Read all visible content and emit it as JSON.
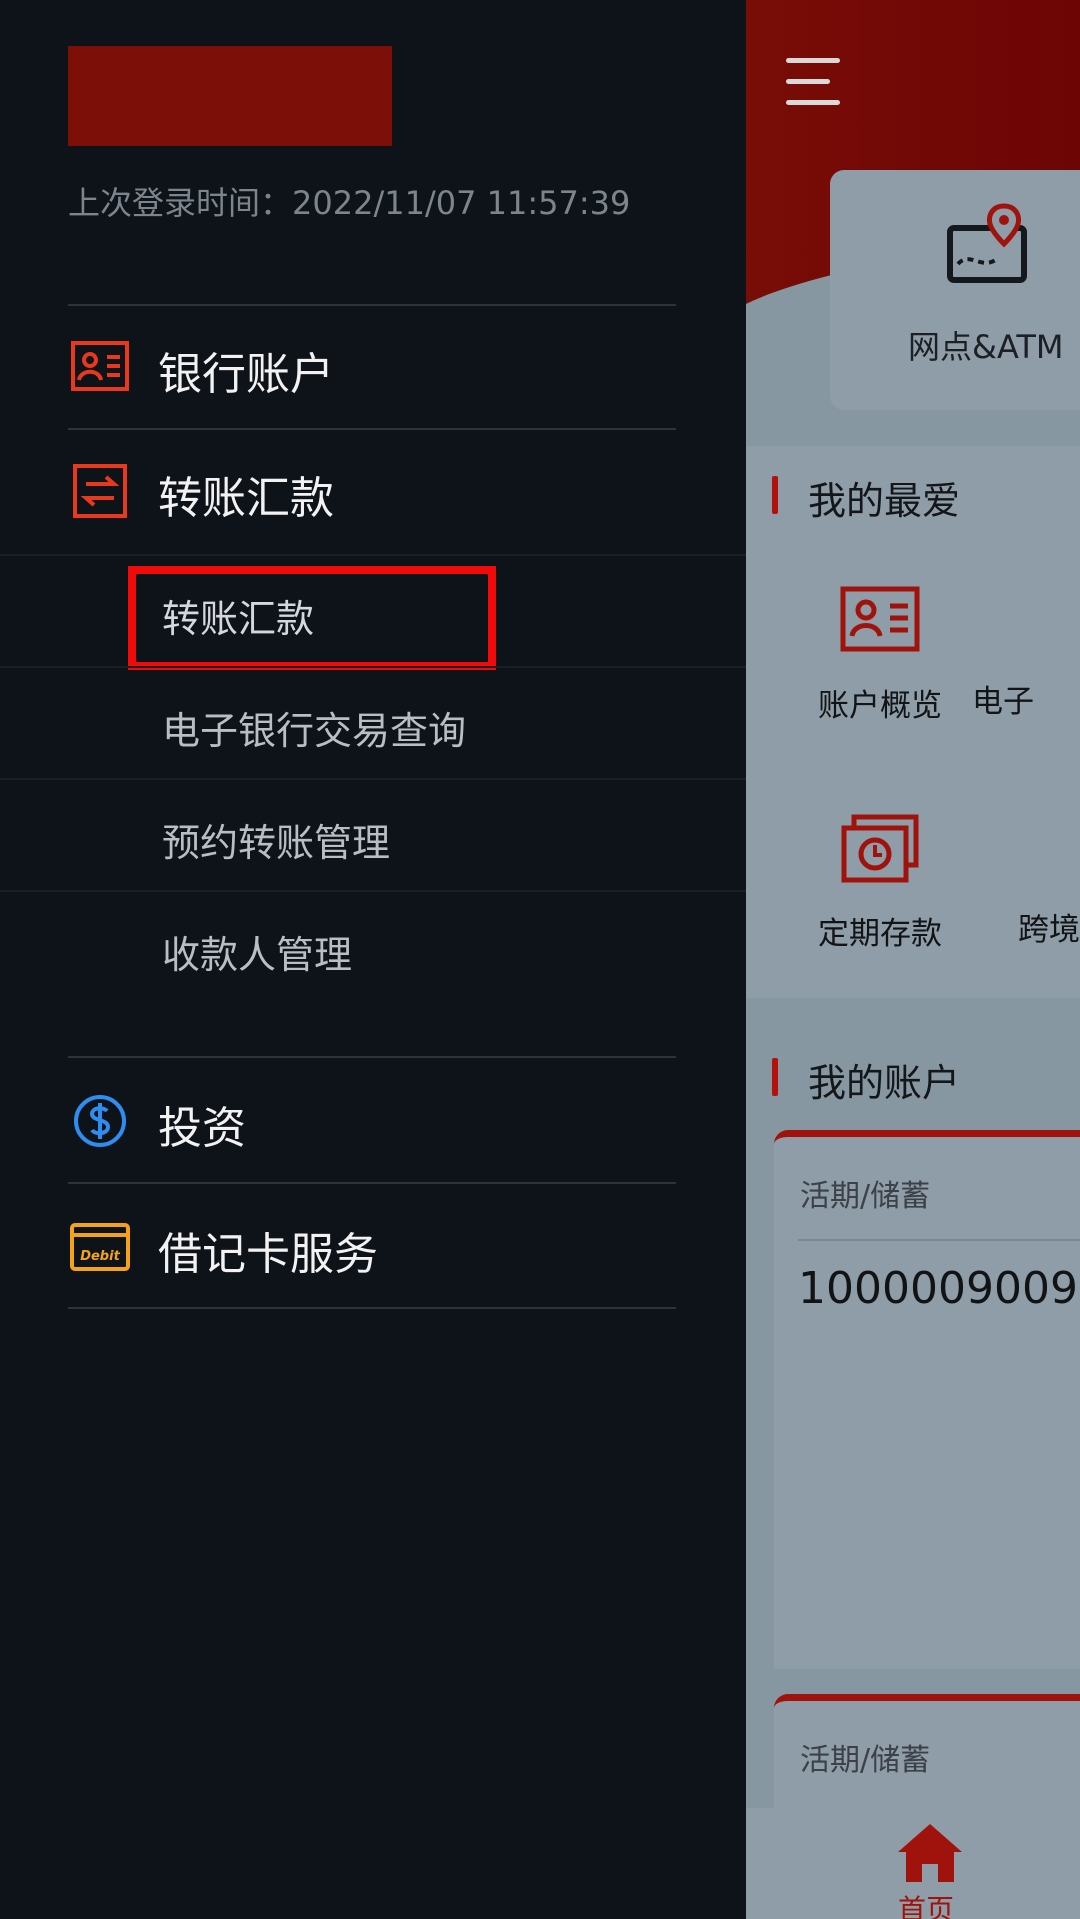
{
  "drawer": {
    "last_login": "上次登录时间：2022/11/07 11:57:39",
    "menu": [
      {
        "label": "银行账户",
        "icon": "account-card-icon"
      },
      {
        "label": "转账汇款",
        "icon": "transfer-icon"
      },
      {
        "label": "投资",
        "icon": "dollar-circle-icon"
      },
      {
        "label": "借记卡服务",
        "icon": "debit-card-icon"
      }
    ],
    "transfer_sub": [
      {
        "label": "转账汇款"
      },
      {
        "label": "电子银行交易查询"
      },
      {
        "label": "预约转账管理"
      },
      {
        "label": "收款人管理"
      }
    ],
    "debit_icon_text": "Debit"
  },
  "main": {
    "quick": {
      "label": "网点&ATM",
      "icon": "map-pin-icon"
    },
    "favorites": {
      "title": "我的最爱",
      "items": [
        {
          "label": "账户概览",
          "icon": "account-card-icon"
        },
        {
          "label": "电子",
          "icon": ""
        },
        {
          "label": "定期存款",
          "icon": "clock-deposit-icon"
        },
        {
          "label": "跨境",
          "icon": ""
        }
      ]
    },
    "accounts": {
      "title": "我的账户",
      "cards": [
        {
          "type": "活期/储蓄",
          "number": "1000009009"
        },
        {
          "type": "活期/储蓄",
          "number": ""
        }
      ]
    },
    "bottom_nav": {
      "home_label": "首页",
      "icon": "home-icon"
    }
  },
  "colors": {
    "drawer_bg": "#0e1319",
    "accent_red": "#e8391d",
    "highlight": "#f00a0a",
    "dollar_blue": "#2d8df0",
    "debit_orange": "#f3a21a"
  }
}
